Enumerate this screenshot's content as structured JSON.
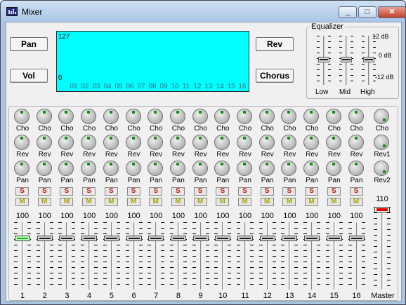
{
  "window": {
    "title": "Mixer",
    "minimize": "_",
    "maximize": "□",
    "close": "✕"
  },
  "buttons": {
    "pan": "Pan",
    "vol": "Vol",
    "rev": "Rev",
    "chorus": "Chorus"
  },
  "display": {
    "top_value": "127",
    "bottom_value": "0",
    "channels": [
      "01",
      "02",
      "03",
      "04",
      "05",
      "06",
      "07",
      "08",
      "09",
      "10",
      "11",
      "12",
      "13",
      "14",
      "15",
      "16"
    ]
  },
  "equalizer": {
    "legend": "Equalizer",
    "scale": [
      "12 dB",
      "0 dB",
      "-12 dB"
    ],
    "bands": [
      {
        "label": "Low",
        "level_db": 0
      },
      {
        "label": "Mid",
        "level_db": 0
      },
      {
        "label": "High",
        "level_db": 0
      }
    ]
  },
  "mixer": {
    "knob_labels": {
      "cho": "Cho",
      "rev": "Rev",
      "pan": "Pan",
      "rev1": "Rev1",
      "rev2": "Rev2"
    },
    "solo_label": "S",
    "mute_label": "M",
    "channels": [
      {
        "number": "1",
        "volume": "100",
        "selected": true
      },
      {
        "number": "2",
        "volume": "100"
      },
      {
        "number": "3",
        "volume": "100"
      },
      {
        "number": "4",
        "volume": "100"
      },
      {
        "number": "5",
        "volume": "100"
      },
      {
        "number": "6",
        "volume": "100"
      },
      {
        "number": "7",
        "volume": "100"
      },
      {
        "number": "8",
        "volume": "100"
      },
      {
        "number": "9",
        "volume": "100"
      },
      {
        "number": "10",
        "volume": "100"
      },
      {
        "number": "11",
        "volume": "100"
      },
      {
        "number": "12",
        "volume": "100"
      },
      {
        "number": "13",
        "volume": "100"
      },
      {
        "number": "14",
        "volume": "100"
      },
      {
        "number": "15",
        "volume": "100"
      },
      {
        "number": "16",
        "volume": "100"
      }
    ],
    "master": {
      "label": "Master",
      "volume": "110"
    }
  }
}
